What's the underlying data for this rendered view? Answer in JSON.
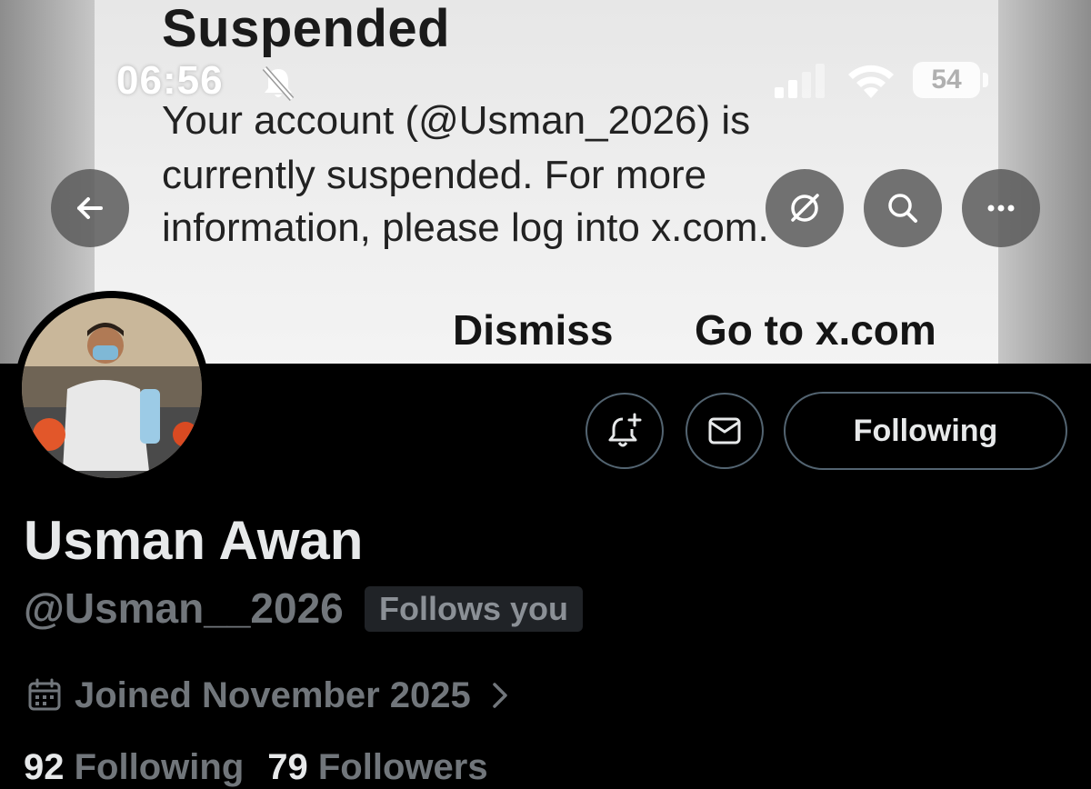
{
  "status_bar": {
    "time": "06:56",
    "battery": "54"
  },
  "banner_dialog": {
    "title": "Suspended",
    "message_lines": [
      "Your account (@Usman_2026) is",
      "currently suspended. For more",
      "information, please log into x.com."
    ],
    "dismiss_label": "Dismiss",
    "goto_label": "Go to x.com"
  },
  "profile": {
    "display_name": "Usman Awan",
    "handle": "@Usman__2026",
    "follows_you_badge": "Follows you",
    "joined": "Joined November 2025",
    "following_count": "92",
    "following_label": "Following",
    "followers_count": "79",
    "followers_label": "Followers",
    "following_button": "Following"
  },
  "icons": {
    "back": "arrow-left-icon",
    "grok": "grok-icon",
    "search": "search-icon",
    "more": "more-horizontal-icon",
    "notify": "bell-plus-icon",
    "message": "envelope-icon",
    "calendar": "calendar-icon",
    "chevron": "chevron-right-icon"
  },
  "colors": {
    "background": "#000000",
    "primary_text": "#e7e9ea",
    "secondary_text": "#71767b",
    "border": "#536471",
    "badge_bg": "#202327"
  }
}
